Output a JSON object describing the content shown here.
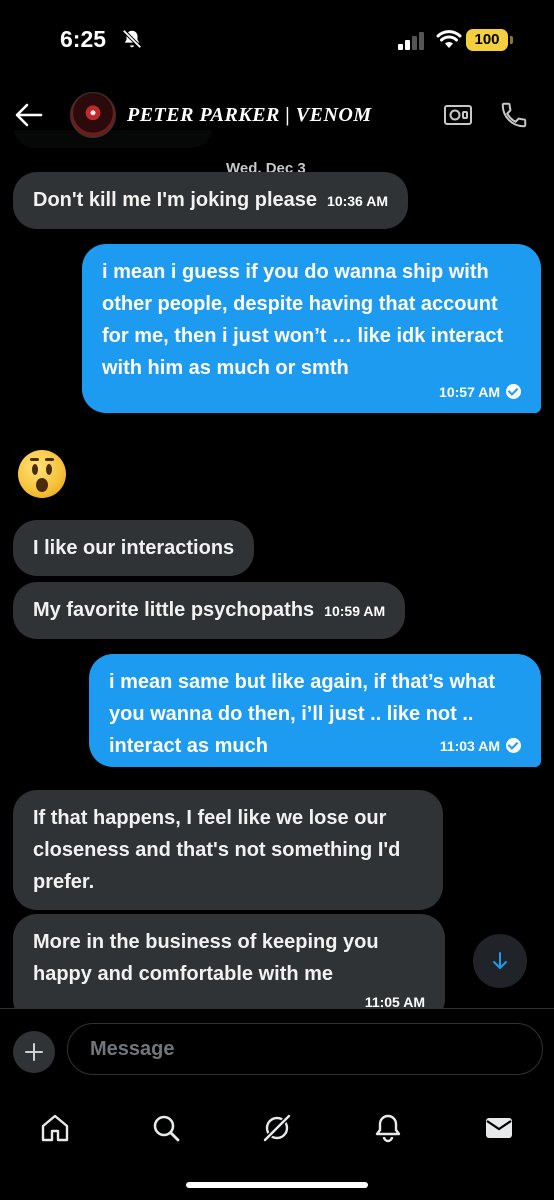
{
  "status_bar": {
    "time": "6:25",
    "battery": "100",
    "battery_color": "#f4d03f"
  },
  "header": {
    "contact_name": "PETER PARKER | VENOM",
    "icons": [
      "back-arrow-icon",
      "video-camera-icon",
      "phone-icon"
    ]
  },
  "colors": {
    "outgoing_bubble": "#1d9bf0",
    "incoming_bubble": "#2f3336",
    "background": "#000000"
  },
  "conversation": {
    "date_separator": "Wed, Dec 3",
    "messages": [
      {
        "from": "contact",
        "text": "Don't kill me I'm joking please",
        "time": "10:36 AM"
      },
      {
        "from": "me",
        "text": "i mean i guess if you do wanna ship with other people, despite having that account for me, then i just won’t … like idk interact with him as much or smth",
        "time": "10:57 AM",
        "read": true
      },
      {
        "from": "contact",
        "text": "😮",
        "emoji_only": true
      },
      {
        "from": "contact",
        "text": "I like our interactions"
      },
      {
        "from": "contact",
        "text": "My favorite little psychopaths",
        "time": "10:59 AM"
      },
      {
        "from": "me",
        "text": "i mean same but like again, if that’s what you wanna do then, i’ll just .. like not .. interact as much",
        "time": "11:03 AM",
        "read": true
      },
      {
        "from": "contact",
        "text": "If that happens, I feel like we lose our closeness and that's not something I'd prefer."
      },
      {
        "from": "contact",
        "text": "More in the business of keeping you happy and comfortable with me",
        "time": "11:05 AM"
      }
    ]
  },
  "composer": {
    "placeholder": "Message"
  },
  "bottom_nav": {
    "items": [
      "home-icon",
      "search-icon",
      "grok-icon",
      "notifications-icon",
      "messages-icon"
    ],
    "active": "messages-icon"
  }
}
